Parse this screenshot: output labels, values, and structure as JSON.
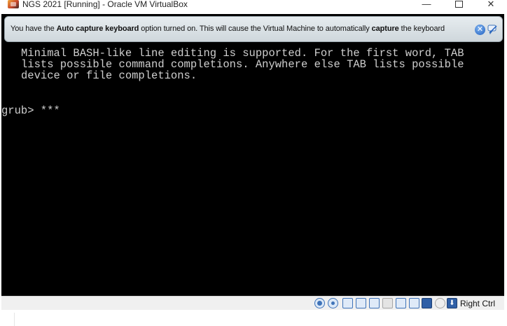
{
  "window": {
    "title": "NGS 2021 [Running] - Oracle VM VirtualBox",
    "minimize_glyph": "—",
    "close_glyph": "✕"
  },
  "notification": {
    "part1": "You have the ",
    "bold1": "Auto capture keyboard",
    "part2": " option turned on. This will cause the Virtual Machine to automatically ",
    "bold2": "capture",
    "part3": " the keyboard",
    "close_glyph": "✕"
  },
  "terminal": {
    "lines": [
      "Minimal BASH-like line editing is supported. For the first word, TAB",
      "lists possible command completions. Anywhere else TAB lists possible",
      "device or file completions."
    ],
    "prompt": "grub> ***"
  },
  "statusbar": {
    "icons": [
      "hard-disk-icon",
      "optical-drive-icon",
      "audio-icon",
      "network-icon",
      "usb-icon",
      "shared-folders-icon",
      "display-icon",
      "video-capture-icon",
      "virtualization-icon",
      "mouse-integration-icon",
      "keyboard-capture-icon"
    ],
    "host_key_label": "Right Ctrl",
    "host_key_glyph": "⬇"
  }
}
